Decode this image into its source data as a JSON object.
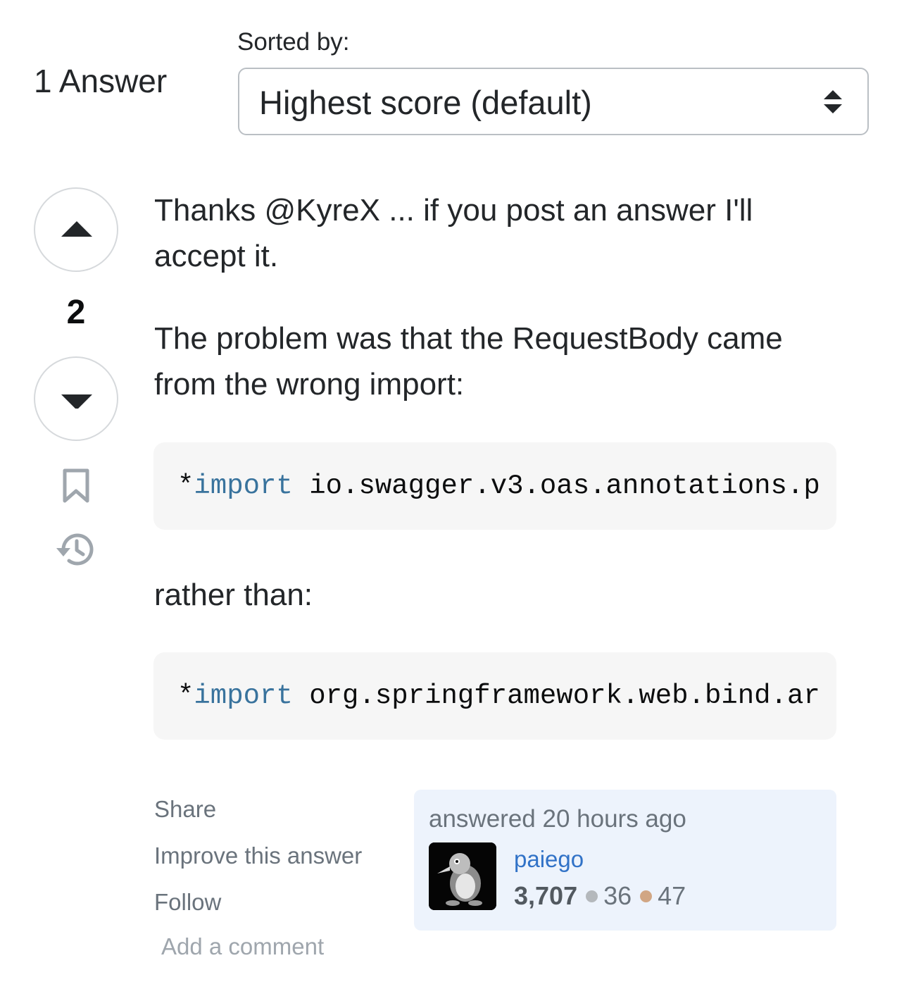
{
  "header": {
    "answers_count": "1 Answer",
    "sort_label": "Sorted by:",
    "sort_selected": "Highest score (default)"
  },
  "votes": {
    "score": "2"
  },
  "post": {
    "paragraph1": "Thanks @KyreX ... if you post an answer I'll accept it.",
    "paragraph2": "The problem was that the RequestBody came from the wrong import:",
    "code1": {
      "prefix": "*",
      "keyword": "import",
      "rest": " io.swagger.v3.oas.annotations.p"
    },
    "paragraph3": "rather than:",
    "code2": {
      "prefix": "*",
      "keyword": "import",
      "rest": " org.springframework.web.bind.ar"
    }
  },
  "post_menu": {
    "share": "Share",
    "improve": "Improve this answer",
    "follow": "Follow",
    "add_comment": "Add a comment"
  },
  "user_card": {
    "action_time": "answered 20 hours ago",
    "user_name": "paiego",
    "reputation": "3,707",
    "silver_badges": "36",
    "bronze_badges": "47"
  },
  "colors": {
    "link_blue": "#3172c7",
    "code_keyword": "#39739d",
    "card_background": "#edf3fc",
    "silver_badge": "#b4b8bc",
    "bronze_badge": "#d1a684"
  }
}
